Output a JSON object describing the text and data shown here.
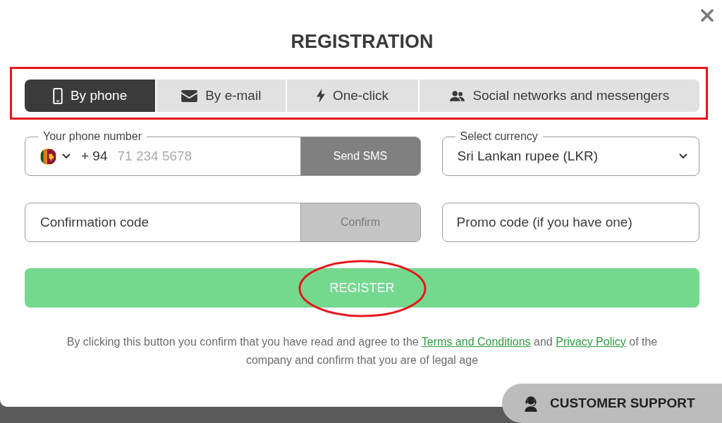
{
  "dialog": {
    "title": "REGISTRATION"
  },
  "tab_bar": {
    "highlighted": true,
    "tabs": [
      {
        "kind": "phone",
        "label": "By phone",
        "selected": true
      },
      {
        "kind": "email",
        "label": "By e-mail",
        "selected": false
      },
      {
        "kind": "one_click",
        "label": "One-click",
        "selected": false
      },
      {
        "kind": "social",
        "label": "Social networks and messengers",
        "selected": false
      }
    ]
  },
  "phone_field": {
    "label": "Your phone number",
    "country_code": "+ 94",
    "placeholder": "71 234 5678",
    "button": {
      "label": "Send SMS",
      "disabled": false
    }
  },
  "currency_field": {
    "label": "Select currency",
    "value": "Sri Lankan rupee (LKR)"
  },
  "confirmation_field": {
    "placeholder": "Confirmation code",
    "button": {
      "label": "Confirm",
      "disabled": true
    }
  },
  "promo_field": {
    "placeholder": "Promo code (if you have one)"
  },
  "register_button": {
    "label": "REGISTER",
    "highlighted": true
  },
  "consent_text": [
    {
      "kind": "text",
      "text": "By clicking this button you confirm that you have read and agree to the"
    },
    {
      "kind": "link",
      "text": "Terms and Conditions"
    },
    {
      "kind": "text",
      "text": "and"
    },
    {
      "kind": "link",
      "text": "Privacy Policy"
    },
    {
      "kind": "text",
      "text": "of the company and confirm that you are of legal age"
    }
  ],
  "support_button": {
    "label": "CUSTOMER SUPPORT"
  }
}
